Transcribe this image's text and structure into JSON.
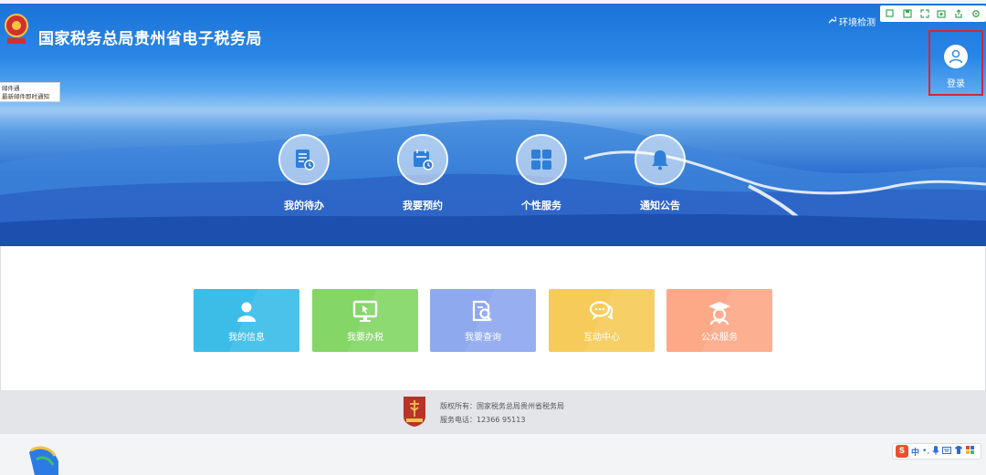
{
  "header": {
    "site_title": "国家税务总局贵州省电子税务局",
    "env_check": "环境检测",
    "login_label": "登录"
  },
  "mail_popup": {
    "title": "邮件通",
    "subtitle": "最新邮件即时通知"
  },
  "features": [
    {
      "label": "我的待办",
      "icon": "document-clock-icon"
    },
    {
      "label": "我要预约",
      "icon": "calendar-clock-icon"
    },
    {
      "label": "个性服务",
      "icon": "grid-icon"
    },
    {
      "label": "通知公告",
      "icon": "bell-icon"
    }
  ],
  "tiles": [
    {
      "label": "我的信息",
      "color": "#3bbde8",
      "icon": "user-icon"
    },
    {
      "label": "我要办税",
      "color": "#84d667",
      "icon": "monitor-icon"
    },
    {
      "label": "我要查询",
      "color": "#8fa9ef",
      "icon": "search-document-icon"
    },
    {
      "label": "互动中心",
      "color": "#f6cb5a",
      "icon": "chat-icon"
    },
    {
      "label": "公众服务",
      "color": "#fda988",
      "icon": "graduate-icon"
    }
  ],
  "footer": {
    "copyright": "版权所有：国家税务总局贵州省税务局",
    "hotline": "服务电话：12366   95113"
  },
  "ime": {
    "lang": "中"
  },
  "colors": {
    "banner_blue": "#1b74d8",
    "login_highlight": "#d6243a"
  }
}
